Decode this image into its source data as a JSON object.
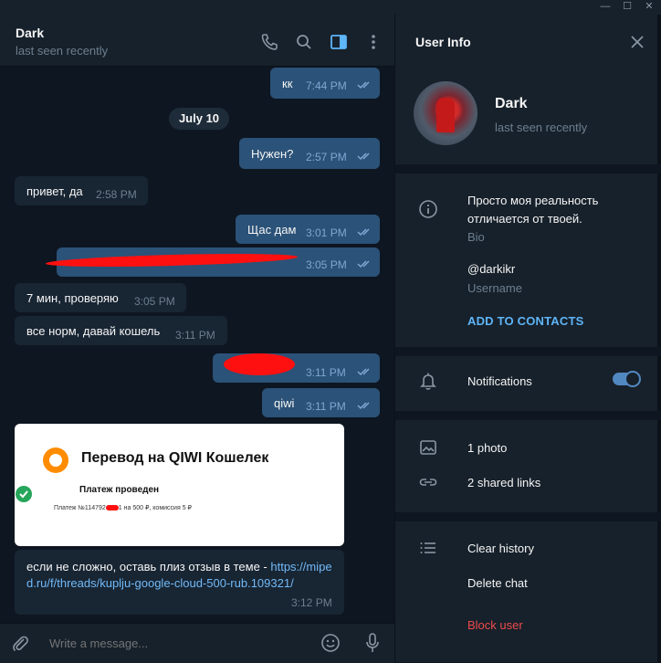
{
  "window": {
    "minimize": "—",
    "maximize": "☐",
    "close": "✕"
  },
  "chat": {
    "name": "Dark",
    "status": "last seen recently",
    "messages": [
      {
        "text": "кк",
        "time": "7:44 PM"
      },
      {
        "date": "July 10"
      },
      {
        "text": "Нужен?",
        "time": "2:57 PM"
      },
      {
        "text": "привет, да",
        "time": "2:58 PM"
      },
      {
        "text": "Щас дам",
        "time": "3:01 PM"
      },
      {
        "text": "",
        "time": "3:05 PM"
      },
      {
        "text": "7 мин, проверяю",
        "time": "3:05 PM"
      },
      {
        "text": "все норм, давай кошель",
        "time": "3:11 PM"
      },
      {
        "text": "",
        "time": "3:11 PM"
      },
      {
        "text": "qiwi",
        "time": "3:11 PM"
      }
    ],
    "qiwi": {
      "title": "Перевод на QIWI Кошелек",
      "status": "Платеж проведен",
      "detail_prefix": "Платеж №114792",
      "detail_suffix": "1 на 500 ₽, комиссия 5 ₽"
    },
    "last_message": {
      "text": "если не сложно, оставь плиз отзыв в теме - ",
      "link": "https://miped.ru/f/threads/kuplju-google-cloud-500-rub.109321/",
      "time": "3:12 PM"
    },
    "compose_placeholder": "Write a message..."
  },
  "info": {
    "title": "User Info",
    "name": "Dark",
    "status": "last seen recently",
    "bio": "Просто моя реальность отличается от твоей.",
    "bio_label": "Bio",
    "username": "@darkikr",
    "username_label": "Username",
    "add_contacts": "ADD TO CONTACTS",
    "notifications": "Notifications",
    "notifications_on": true,
    "photos": "1 photo",
    "links": "2 shared links",
    "clear_history": "Clear history",
    "delete_chat": "Delete chat",
    "block_user": "Block user"
  },
  "colors": {
    "outgoing": "#2b5278",
    "incoming": "#182533",
    "accent": "#5eb5f7",
    "danger": "#ec4b4b"
  }
}
